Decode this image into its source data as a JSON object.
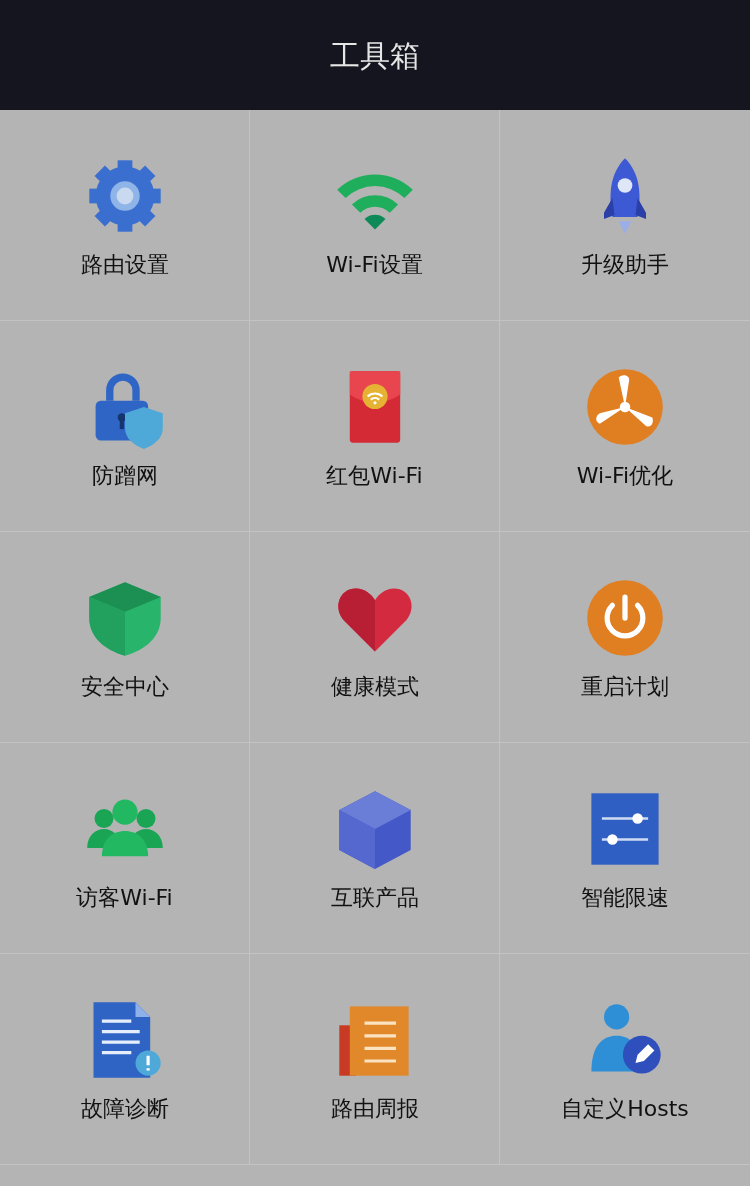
{
  "header": {
    "title": "工具箱"
  },
  "tools": [
    {
      "label": "路由设置"
    },
    {
      "label": "Wi-Fi设置"
    },
    {
      "label": "升级助手"
    },
    {
      "label": "防蹭网"
    },
    {
      "label": "红包Wi-Fi"
    },
    {
      "label": "Wi-Fi优化"
    },
    {
      "label": "安全中心"
    },
    {
      "label": "健康模式"
    },
    {
      "label": "重启计划"
    },
    {
      "label": "访客Wi-Fi"
    },
    {
      "label": "互联产品"
    },
    {
      "label": "智能限速"
    },
    {
      "label": "故障诊断"
    },
    {
      "label": "路由周报"
    },
    {
      "label": "自定义Hosts"
    }
  ]
}
